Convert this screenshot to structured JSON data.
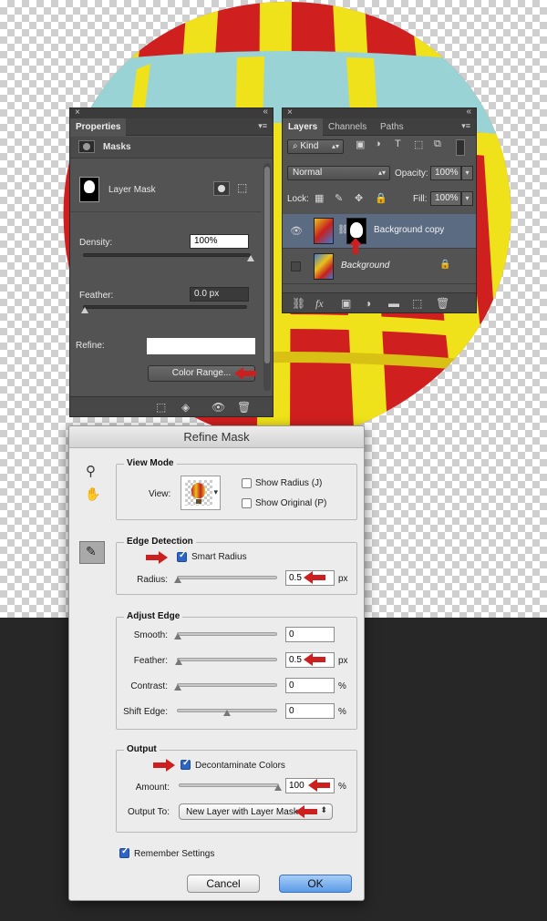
{
  "properties": {
    "tab": "Properties",
    "section": "Masks",
    "mask_type": "Layer Mask",
    "density_label": "Density:",
    "density_value": "100%",
    "density_level": 1.0,
    "feather_label": "Feather:",
    "feather_value": "0.0 px",
    "feather_level": 0.0,
    "refine_label": "Refine:",
    "color_range_button": "Color Range..."
  },
  "layers": {
    "tabs": [
      "Layers",
      "Channels",
      "Paths"
    ],
    "filter_kind": "Kind",
    "blend_mode": "Normal",
    "opacity_label": "Opacity:",
    "opacity_value": "100%",
    "lock_label": "Lock:",
    "fill_label": "Fill:",
    "fill_value": "100%",
    "items": [
      {
        "name": "Background copy",
        "visible": true,
        "selected": true
      },
      {
        "name": "Background",
        "visible": false,
        "selected": false
      }
    ]
  },
  "refine_mask": {
    "title": "Refine Mask",
    "view_mode": {
      "title": "View Mode",
      "view_label": "View:",
      "show_radius": "Show Radius (J)",
      "show_radius_checked": false,
      "show_original": "Show Original (P)",
      "show_original_checked": false
    },
    "edge_detection": {
      "title": "Edge Detection",
      "smart_radius": "Smart Radius",
      "smart_radius_checked": true,
      "radius_label": "Radius:",
      "radius_value": "0.5",
      "radius_level": 0.0,
      "radius_unit": "px"
    },
    "adjust_edge": {
      "title": "Adjust Edge",
      "smooth_label": "Smooth:",
      "smooth_value": "0",
      "feather_label": "Feather:",
      "feather_value": "0.5",
      "feather_unit": "px",
      "contrast_label": "Contrast:",
      "contrast_value": "0",
      "contrast_unit": "%",
      "shift_label": "Shift Edge:",
      "shift_value": "0",
      "shift_unit": "%"
    },
    "output": {
      "title": "Output",
      "decontaminate": "Decontaminate Colors",
      "decontaminate_checked": true,
      "amount_label": "Amount:",
      "amount_value": "100",
      "amount_unit": "%",
      "output_to_label": "Output To:",
      "output_to_value": "New Layer with Layer Mask"
    },
    "remember": "Remember Settings",
    "remember_checked": true,
    "cancel": "Cancel",
    "ok": "OK"
  },
  "colors": {
    "annotation_arrow": "#cc1f1f",
    "balloon_red": "#d01f1f",
    "balloon_yellow": "#f0e21a",
    "balloon_blue": "#9ad3d6",
    "ok_button": "#5c9be8"
  }
}
